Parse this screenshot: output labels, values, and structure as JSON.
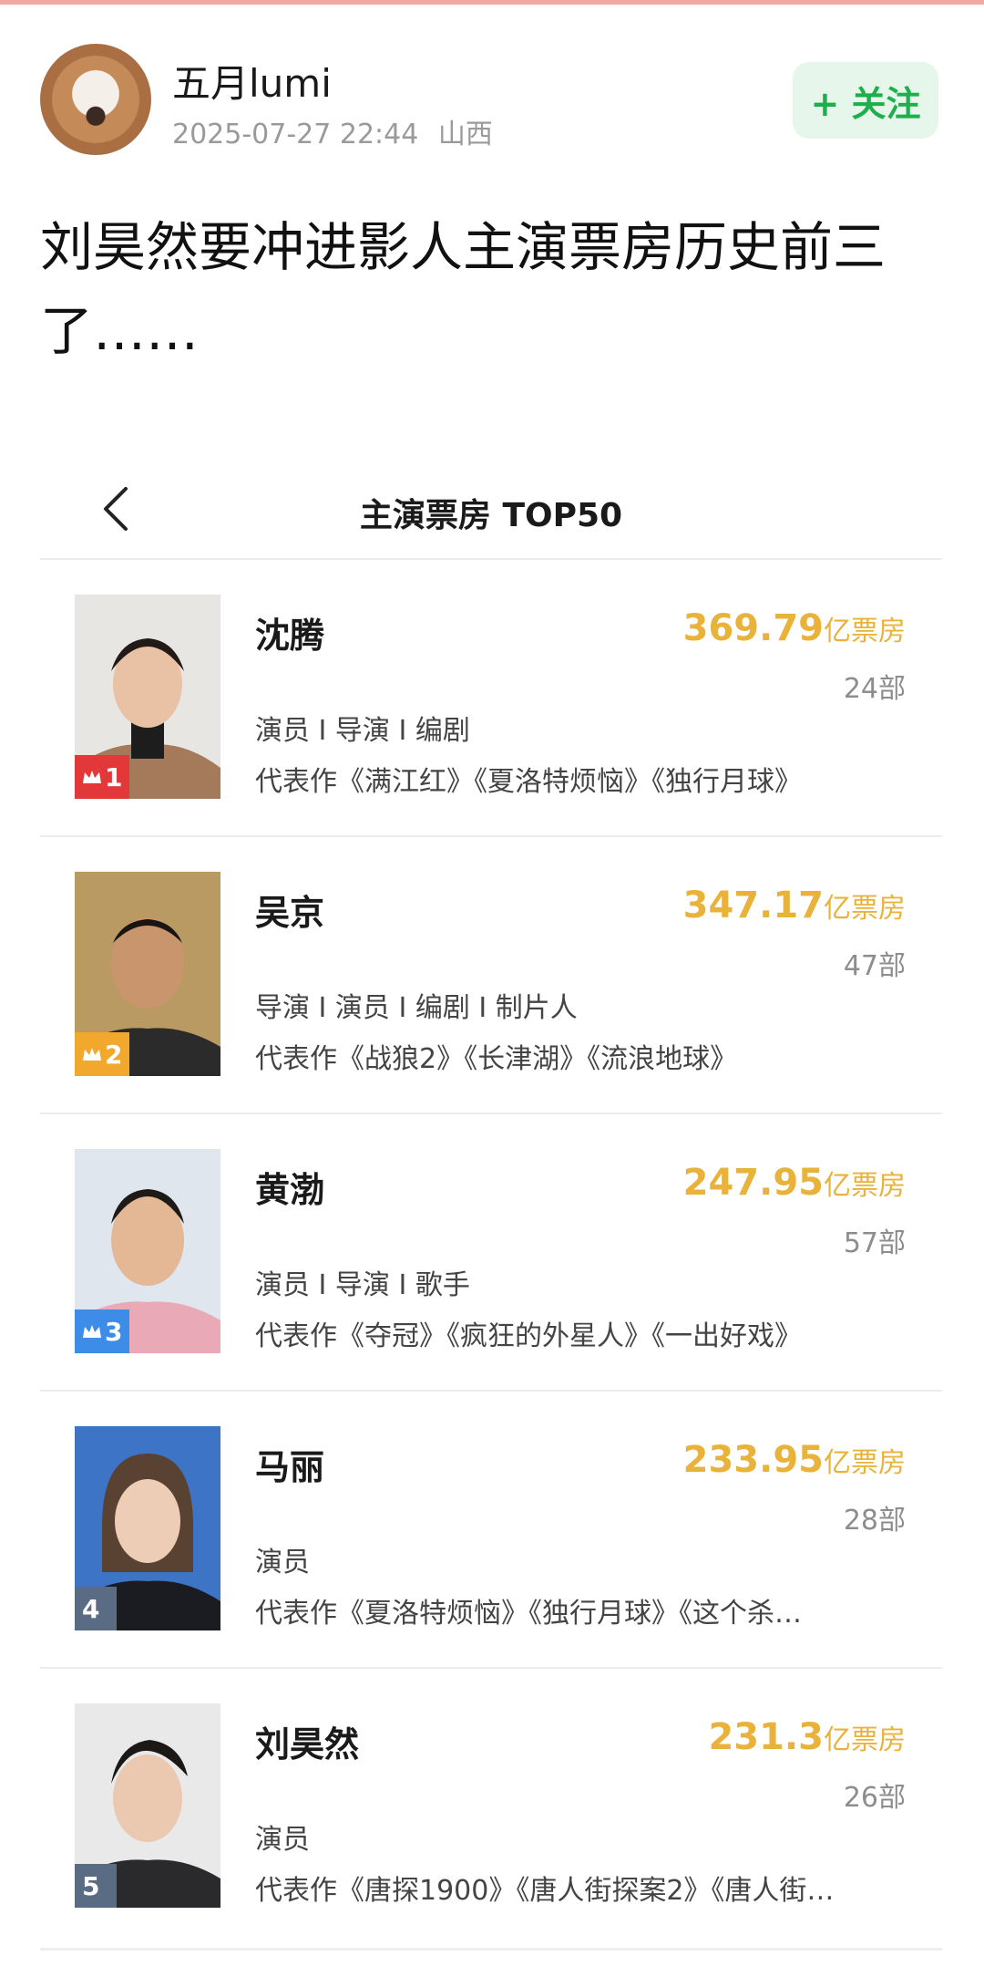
{
  "author": {
    "name": "五月lumi",
    "time": "2025-07-27 22:44",
    "location": "山西",
    "follow_label": "+ 关注"
  },
  "post": {
    "text": "刘昊然要冲进影人主演票房历史前三了……"
  },
  "list": {
    "title": "主演票房 TOP50",
    "unit": "亿票房",
    "items": [
      {
        "rank": "1",
        "name": "沈腾",
        "box": "369.79",
        "films": "24部",
        "roles": "演员 I 导演 I 编剧",
        "works": "代表作《满江红》《夏洛特烦恼》《独行月球》"
      },
      {
        "rank": "2",
        "name": "吴京",
        "box": "347.17",
        "films": "47部",
        "roles": "导演 I 演员 I 编剧 I 制片人",
        "works": "代表作《战狼2》《长津湖》《流浪地球》"
      },
      {
        "rank": "3",
        "name": "黄渤",
        "box": "247.95",
        "films": "57部",
        "roles": "演员 I 导演 I 歌手",
        "works": "代表作《夺冠》《疯狂的外星人》《一出好戏》"
      },
      {
        "rank": "4",
        "name": "马丽",
        "box": "233.95",
        "films": "28部",
        "roles": "演员",
        "works": "代表作《夏洛特烦恼》《独行月球》《这个杀…"
      },
      {
        "rank": "5",
        "name": "刘昊然",
        "box": "231.3",
        "films": "26部",
        "roles": "演员",
        "works": "代表作《唐探1900》《唐人街探案2》《唐人街…"
      }
    ]
  },
  "colors": {
    "accent_gold": "#e9b23a",
    "follow_green": "#1fae4c",
    "rank1": "#e2383a",
    "rank2": "#f2a72d",
    "rank3": "#3d8de8",
    "rank_other": "#5a6b84"
  },
  "icons": {
    "back": "chevron-left-icon",
    "crown": "crown-icon"
  }
}
